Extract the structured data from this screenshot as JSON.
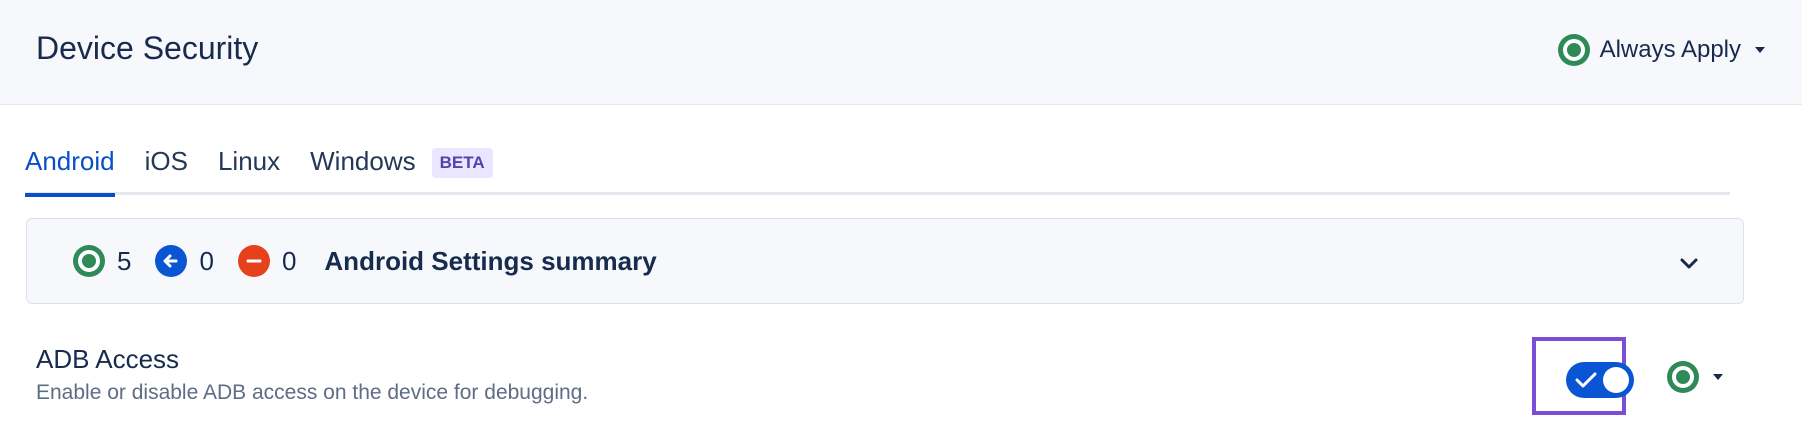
{
  "header": {
    "title": "Device Security",
    "policy_label": "Always Apply"
  },
  "tabs": [
    {
      "label": "Android",
      "active": true
    },
    {
      "label": "iOS",
      "active": false
    },
    {
      "label": "Linux",
      "active": false
    },
    {
      "label": "Windows",
      "active": false,
      "badge": "BETA"
    }
  ],
  "summary": {
    "applied_count": "5",
    "inherited_count": "0",
    "excluded_count": "0",
    "title": "Android Settings summary"
  },
  "setting": {
    "title": "ADB Access",
    "description": "Enable or disable ADB access on the device for debugging.",
    "enabled": true
  },
  "colors": {
    "green": "#2e8b57",
    "blue": "#0a55d3",
    "red": "#e5411b",
    "purple_focus": "#7a4ed6"
  },
  "icons": {
    "policy": "status-ring-icon",
    "applied": "status-ring-icon",
    "inherited": "arrow-left-icon",
    "excluded": "minus-icon",
    "expand": "chevron-down-icon",
    "toggle": "check-icon"
  }
}
